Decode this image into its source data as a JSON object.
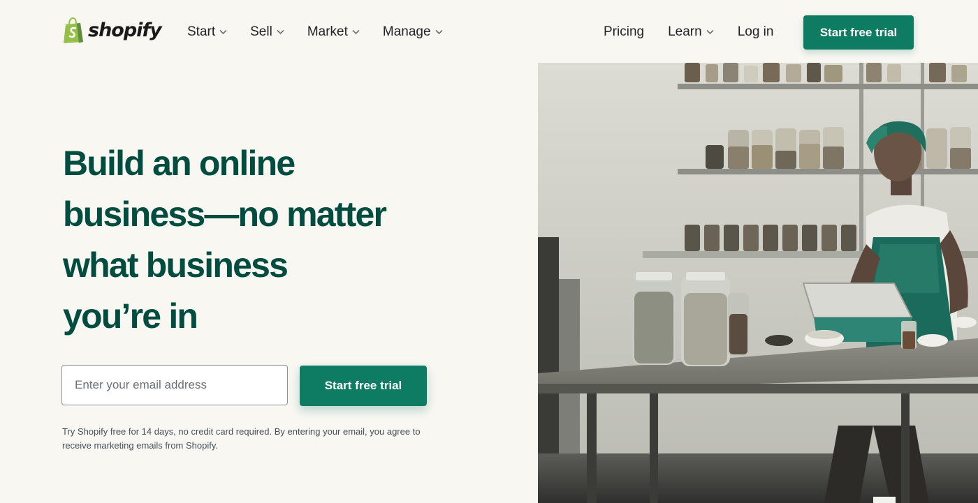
{
  "brand": {
    "name": "shopify",
    "accent_color": "#0e7b63",
    "heading_color": "#004c3f",
    "background_color": "#f9f7f2"
  },
  "nav": {
    "left_items": [
      {
        "label": "Start",
        "icon": "chevron-down-icon"
      },
      {
        "label": "Sell",
        "icon": "chevron-down-icon"
      },
      {
        "label": "Market",
        "icon": "chevron-down-icon"
      },
      {
        "label": "Manage",
        "icon": "chevron-down-icon"
      }
    ],
    "right_items": {
      "pricing": "Pricing",
      "learn": "Learn",
      "login": "Log in"
    },
    "cta_label": "Start free trial"
  },
  "hero": {
    "title_lines": [
      "Build an online",
      "business—no matter",
      "what business",
      "you’re in"
    ],
    "email_placeholder": "Enter your email address",
    "cta_label": "Start free trial",
    "disclaimer": "Try Shopify free for 14 days, no credit card required. By entering your email, you agree to receive marketing emails from Shopify.",
    "image": "photo-woman-working-on-tablet-in-kitchen-with-jars"
  }
}
